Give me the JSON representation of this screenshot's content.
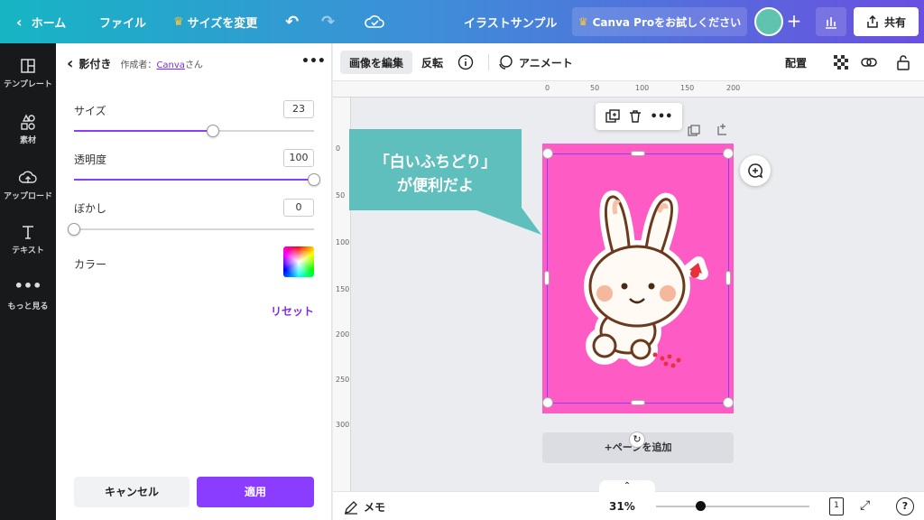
{
  "topbar": {
    "home": "ホーム",
    "file": "ファイル",
    "resize": "サイズを変更",
    "doc_title": "イラストサンプル",
    "pro_trial": "Canva Proをお試しください",
    "share": "共有",
    "plus": "+"
  },
  "rail": {
    "items": [
      {
        "label": "テンプレート",
        "icon": "template-icon"
      },
      {
        "label": "素材",
        "icon": "elements-icon"
      },
      {
        "label": "アップロード",
        "icon": "upload-icon"
      },
      {
        "label": "テキスト",
        "icon": "text-icon"
      },
      {
        "label": "もっと見る",
        "icon": "more-icon"
      }
    ]
  },
  "panel": {
    "title": "影付き",
    "author_prefix": "作成者：",
    "author_link": "Canva",
    "author_suffix": "さん",
    "size_label": "サイズ",
    "size_value": "23",
    "size_fraction": 0.58,
    "opacity_label": "透明度",
    "opacity_value": "100",
    "opacity_fraction": 1.0,
    "blur_label": "ぼかし",
    "blur_value": "0",
    "blur_fraction": 0.0,
    "color_label": "カラー",
    "reset": "リセット",
    "cancel": "キャンセル",
    "apply": "適用"
  },
  "toolbar": {
    "edit_image": "画像を編集",
    "flip": "反転",
    "animate": "アニメート",
    "position": "配置"
  },
  "ruler": {
    "h": [
      "0",
      "50",
      "100",
      "150",
      "200"
    ],
    "v": [
      "0",
      "50",
      "100",
      "150",
      "200",
      "250",
      "300"
    ]
  },
  "canvas": {
    "add_page": "+ページを追加",
    "page_color": "#ff5bc4"
  },
  "callout": {
    "line1": "「白いふちどり」",
    "line2": "が便利だよ"
  },
  "bottom": {
    "notes": "メモ",
    "zoom": "31%",
    "zoom_fraction": 0.29,
    "page_num": "1",
    "help": "?"
  }
}
